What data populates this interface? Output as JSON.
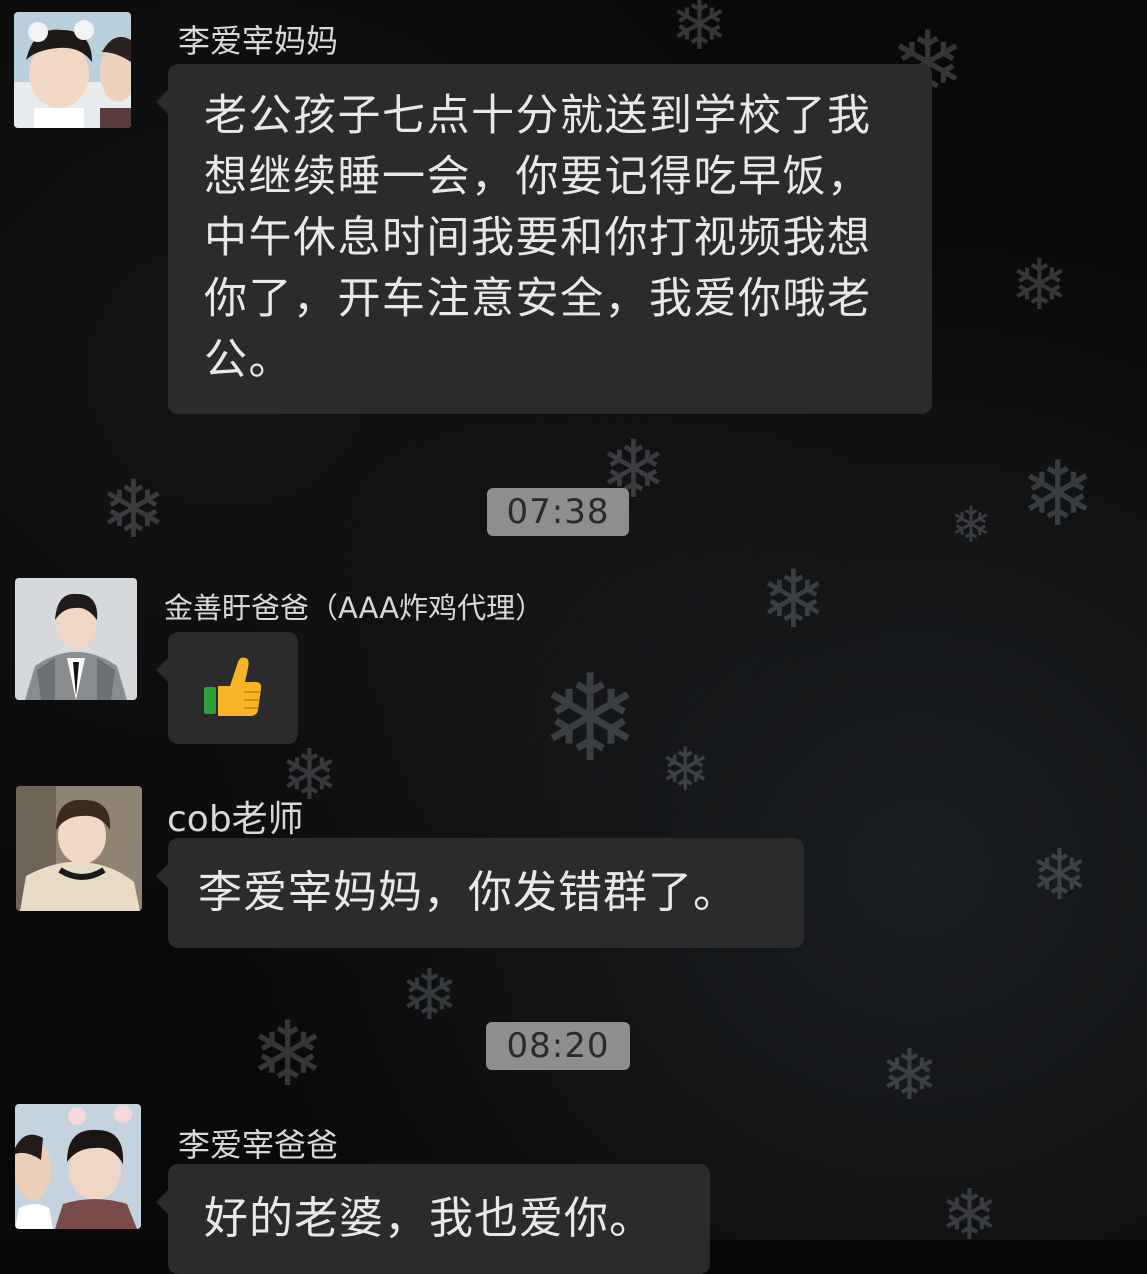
{
  "messages": [
    {
      "sender": "李爱宰妈妈",
      "text": "老公孩子七点十分就送到学校了我想继续睡一会，你要记得吃早饭，中午休息时间我要和你打视频我想你了，开车注意安全，我爱你哦老公。"
    },
    {
      "timestamp": "07:38"
    },
    {
      "sender": "金善盱爸爸（AAA炸鸡代理）",
      "sticker": "thumbs-up"
    },
    {
      "sender": "cob老师",
      "text": "李爱宰妈妈，你发错群了。"
    },
    {
      "timestamp": "08:20"
    },
    {
      "sender": "李爱宰爸爸",
      "text": "好的老婆，我也爱你。"
    }
  ],
  "colors": {
    "background": "#090909",
    "bubble": "#2b2b2b",
    "timestamp_bg": "#8e8e8e",
    "thumb_yellow": "#f6b526",
    "thumb_green": "#2e9e3a"
  }
}
